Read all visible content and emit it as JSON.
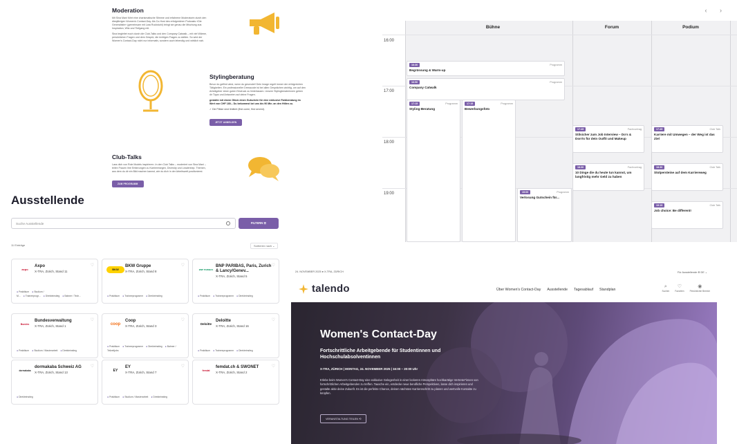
{
  "features": [
    {
      "title": "Moderation",
      "body": "Mit Sina Mani führt eine charismatische Stimme und erfahrene Moderatorin durch den diesjährigen Women's Contact-Day. Als Co-Host des erfolgreichen Podcasts «Die Generalistin» (gemeinsam mit Lara Ruckstuhl) bringt sie genau die Mischung aus Inspiration, Witz und Tiefgang mit.",
      "body2": "Sina begleitet euch durch die Club-Talks und den Company Catwalk – mit viel Wärme, persönlichen Fragen und dem Gespür, die richtigen Fragen zu stellen. So wird der Women's Contact-Day nicht nur informativ, sondern auch lebendig und wirklich nah."
    },
    {
      "title": "Stylingberatung",
      "body": "Bevor du gefilmt wirst, wenn du gesendet! Dein Image regelt immer der erfolgreichen Tätigkeiten. Ein professioneller Dresscode ist bei allen Gesprächen wichtig, um auf den Arbeitgeber einen guten Eindruck zu hinterlassen. Unsere Stylingberaterinnen geben dir Tipps und Antworten auf deine Fragen.",
      "body_bold": "gestalte mit einem Glück einen Gutschein für eine exklusive Farbberatung im Wert von CHF 180.– Du bekommst bei uns bis 90 Min. an den Hitlen zu.",
      "note": "Die Plätze sind limitiert (first come, first served).",
      "button": "JETZT ANMELDEN"
    },
    {
      "title": "Club-Talks",
      "body": "Lass dich von Role Models inspirieren. In den Club Talks – moderiert von Sina Mani – teilen Frauen ihre Erfahrungen zu Karrierewegen, Diversity und Leadership. Themen, aus dem du dir ein Bild machen kannst, wie du dich in der Arbeitswelt positionierst.",
      "button": "ZUM PROGRAMM"
    }
  ],
  "schedule": {
    "nav": "‹   ›",
    "columns": [
      "Bühne",
      "Forum",
      "Podium"
    ],
    "times": [
      "16:00",
      "17:00",
      "18:00",
      "19:00"
    ],
    "events": [
      {
        "time": "16:30",
        "type": "Programm",
        "title": "Begrüssung & Warm-up"
      },
      {
        "time": "16:50",
        "type": "Programm",
        "title": "Company Catwalk"
      },
      {
        "time": "17:15",
        "type": "Programm",
        "title": "Styling-Beratung"
      },
      {
        "time": "17:15",
        "type": "Programm",
        "title": "Bewerbungsfoto"
      },
      {
        "time": "17:45",
        "type": "Fachvortrag",
        "title": "Stilsicher zum Job Interview – Do's & Don'ts für dein Outfit und Makeup"
      },
      {
        "time": "18:30",
        "type": "Fachvortrag",
        "title": "10 Dinge die du heute tun kannst, um langfristig mehr Geld zu haben"
      },
      {
        "time": "19:00",
        "type": "Programm",
        "title": "Verlosung Gutschein für..."
      },
      {
        "time": "17:45",
        "type": "Club Talk",
        "title": "Karriere mit Umwegen – der Weg ist das Ziel"
      },
      {
        "time": "18:30",
        "type": "Club Talk",
        "title": "Stolpersteine auf dem Karriereweg"
      },
      {
        "time": "19:15",
        "type": "Club Talk",
        "title": "Job choice: Be different!"
      }
    ]
  },
  "exhibitors": {
    "title": "Ausstellende",
    "search_placeholder": "Suche Ausstellende",
    "filter_label": "FILTERN  ☰",
    "count": "11 Einträge",
    "sort": "Sortieren nach  ⌄",
    "cards": [
      {
        "logo": "axpo",
        "name": "Axpo",
        "loc": "X-TRA, Zürich, Stand 11",
        "tags": [
          "Praktikum",
          "Studium / M...",
          "Traineeprogr...",
          "Direkteinstieg",
          "Bahner / Tech..."
        ]
      },
      {
        "logo": "BKW",
        "name": "BKW Gruppe",
        "loc": "X-TRA, Zürich, Stand 8",
        "tags": [
          "Praktikum",
          "Traineeprogramm",
          "Direkteinstieg"
        ]
      },
      {
        "logo": "BNP PARIBAS",
        "name": "BNP PARIBAS, Paris, Zurich & Lancy/Genev...",
        "loc": "X-TRA, Zürich, Stand 5",
        "tags": [
          "Praktikum",
          "Traineeprogramm",
          "Direkteinstieg"
        ]
      },
      {
        "logo": "Bundes",
        "name": "Bundesverwaltung",
        "loc": "X-TRA, Zürich, Stand 1",
        "tags": [
          "Praktikum",
          "Studium / Masterarbeit",
          "Direkteinstieg"
        ]
      },
      {
        "logo": "coop",
        "name": "Coop",
        "loc": "X-TRA, Zürich, Stand 3",
        "tags": [
          "Praktikum",
          "Traineeprogramm",
          "Direkteinstieg",
          "Bahner / Teilzeitjobs"
        ]
      },
      {
        "logo": "Deloitte",
        "name": "Deloitte",
        "loc": "X-TRA, Zürich, Stand 16",
        "tags": [
          "Praktikum",
          "Traineeprogramm",
          "Direkteinstieg"
        ]
      },
      {
        "logo": "dormakaba",
        "name": "dormakaba Schweiz AG",
        "loc": "X-TRA, Zürich, Stand 13",
        "tags": [
          "Direkteinstieg"
        ]
      },
      {
        "logo": "EY",
        "name": "EY",
        "loc": "X-TRA, Zürich, Stand 7",
        "tags": [
          "Praktikum",
          "Studium / Masterarbeit",
          "Direkteinstieg"
        ]
      },
      {
        "logo": "femdat",
        "name": "femdat.ch & SWONET",
        "loc": "X-TRA, Zürich, Stand 2",
        "tags": []
      }
    ]
  },
  "hero": {
    "date_line": "24. NOVEMBER 2025  ●  X-TRA, ZÜRICH",
    "topright": "Für Ausstellende     ⊕ DE  ⌄",
    "logo": "talendo",
    "nav": [
      "Über Women's Contact-Day",
      "Ausstellende",
      "Tagesablauf",
      "Standplan"
    ],
    "icons": [
      {
        "glyph": "⌕",
        "label": "Suchen"
      },
      {
        "glyph": "♡",
        "label": "Favoriten"
      },
      {
        "glyph": "◉",
        "label": "Persönlicher Bereich"
      }
    ],
    "title": "Women's Contact-Day",
    "subtitle": "Fortschrittliche Arbeitgebende für Studentinnen und Hochschulabsolventinnen",
    "meta": "X-TRA, ZÜRICH | MONTAG, 24. NOVEMBER 2025 | 16:00 – 20:00 Uhr",
    "desc": "Erlebe beim Women's Contact-Day eine exklusive Gelegenheit in einer lockeren Atmosphäre hochkarätige Vertreter*innen von fortschrittlichen Arbeitgebenden zu treffen. Tausche ein, entdecke neue berufliche Perspektiven, lasse dich inspirieren und gestalte aktiv deine Zukunft. Es ist die perfekte Chance, deinen nächsten Karriereschritt zu planen und wertvolle Kontakte zu knüpfen.",
    "cta": "VERANSTALTUNG TEILEN  ⟲"
  },
  "colors": {
    "accent": "#7a5ea8",
    "icon_yellow": "#f2b632"
  }
}
